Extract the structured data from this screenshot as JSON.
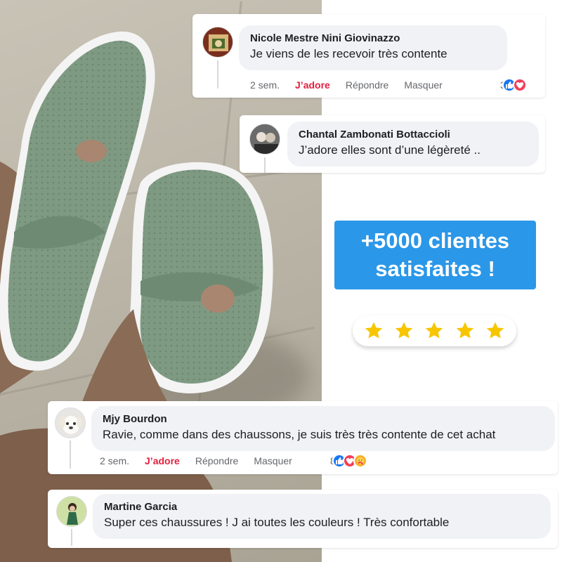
{
  "comments": [
    {
      "name": "Nicole Mestre Nini Giovinazzo",
      "text": "Je viens de les recevoir très contente",
      "time": "2 sem.",
      "react_label": "J’adore",
      "reply_label": "Répondre",
      "hide_label": "Masquer",
      "reaction_count": "3",
      "reactions": [
        "like-icon",
        "love-icon"
      ]
    },
    {
      "name": "Chantal Zambonati Bottaccioli",
      "text": "J’adore elles sont d’une légèreté .."
    },
    {
      "name": "Mjy Bourdon",
      "text": "Ravie, comme dans des chaussons, je suis très très contente de cet achat",
      "time": "2 sem.",
      "react_label": "J’adore",
      "reply_label": "Répondre",
      "hide_label": "Masquer",
      "reaction_count": "8",
      "reactions": [
        "like-icon",
        "love-icon",
        "care-icon"
      ]
    },
    {
      "name": "Martine Garcia",
      "text": "Super ces chaussures ! J ai toutes les couleurs ! Très confortable"
    }
  ],
  "badge": {
    "line1": "+5000 clientes",
    "line2": "satisfaites !"
  },
  "rating": {
    "stars": 5,
    "max": 5
  },
  "colors": {
    "badge_bg": "#2b97e8",
    "star": "#f7c600",
    "love_text": "#e41e3f",
    "bubble_bg": "#f0f2f5",
    "shoe": "#7f9a82",
    "sole": "#f4f4f4"
  }
}
